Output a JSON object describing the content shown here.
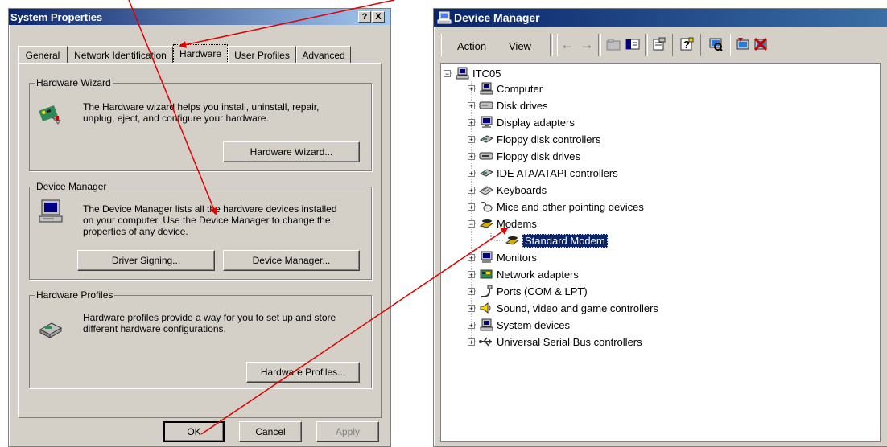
{
  "system_properties": {
    "title": "System Properties",
    "help_button": "?",
    "close_button": "X",
    "tabs": [
      "General",
      "Network Identification",
      "Hardware",
      "User Profiles",
      "Advanced"
    ],
    "hardware_wizard": {
      "group_label": "Hardware Wizard",
      "text_line1": "The Hardware wizard helps you install, uninstall, repair,",
      "text_line2": "unplug, eject, and configure your hardware.",
      "button": "Hardware Wizard..."
    },
    "device_manager": {
      "group_label": "Device Manager",
      "text_line1": "The Device Manager lists all the hardware devices installed",
      "text_line2": "on your computer. Use the Device Manager to change the",
      "text_line3": "properties of any device.",
      "driver_signing_button": "Driver Signing...",
      "device_manager_button": "Device Manager..."
    },
    "hardware_profiles": {
      "group_label": "Hardware Profiles",
      "text_line1": "Hardware profiles provide a way for you to set up and store",
      "text_line2": "different hardware configurations.",
      "button": "Hardware Profiles..."
    },
    "ok_button": "OK",
    "cancel_button": "Cancel",
    "apply_button": "Apply"
  },
  "device_manager_window": {
    "title": "Device Manager",
    "menu": {
      "action": "Action",
      "view": "View"
    },
    "tree": {
      "root": "ITC05",
      "items": [
        "Computer",
        "Disk drives",
        "Display adapters",
        "Floppy disk controllers",
        "Floppy disk drives",
        "IDE ATA/ATAPI controllers",
        "Keyboards",
        "Mice and other pointing devices",
        "Modems",
        "Standard Modem",
        "Monitors",
        "Network adapters",
        "Ports (COM & LPT)",
        "Sound, video and game controllers",
        "System devices",
        "Universal Serial Bus controllers"
      ]
    }
  },
  "colors": {
    "title_bar": "#0a246a",
    "dialog_bg": "#d4d0c8",
    "arrow": "#e00000",
    "selection": "#0a246a"
  }
}
